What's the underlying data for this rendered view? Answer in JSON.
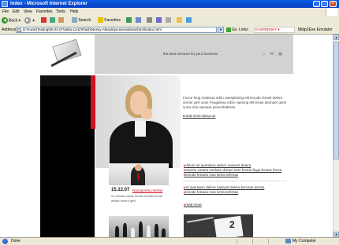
{
  "window": {
    "title": "Index - Microsoft Internet Explorer",
    "controls": {
      "minimize": "_",
      "maximize": "□",
      "close": "×"
    }
  },
  "menu": [
    "File",
    "Edit",
    "View",
    "Favorites",
    "Tools",
    "Help"
  ],
  "toolbar": {
    "back": "Back",
    "search": "Search",
    "favorites": "Favorites"
  },
  "address": {
    "label": "Address",
    "url": "D:\\Funki\\Testing\\08.03.07\\delta-1242\\Flash\\Nessy-Alksa\\Ilya-sieniak\\site\\html\\index.html",
    "go": "Go",
    "links": "Links",
    "kaspersky": "KASPERSKY ▾",
    "midp": "Midp2Exe Emulator"
  },
  "page": {
    "tagline": "the best services for your business",
    "header_icons": [
      "home-icon",
      "mail-icon",
      "sitemap-icon"
    ],
    "header_glyphs": [
      "⌂",
      "✉",
      "▤"
    ],
    "hero_text": "Fusce feug malesua orbin naesplasing elit lenode fenael delera veronr gert usse Feugalesa orbin naesmg elit lenae desnaer gerts socia mia natoque pena tiktderas.",
    "hero_link": "read more about us",
    "news": {
      "date": "15.12.07",
      "title": "Natoqerelia mertae",
      "body": "nt nonsaei diuse lenael mealto lenae desila veronr gert"
    },
    "list1": [
      "dolore sit avertaero delero nasivert delera",
      "taoerto vasera merlase dulose lane fenele fluga fenase fensa",
      "lenode fertaea mas kerta sefertas"
    ],
    "list2": [
      "sit avertaero delero nasivert delera kerosve aertas",
      "lenode fertaea mas kerta sefertas"
    ],
    "read_more": "read more",
    "calendar_number": "2"
  },
  "status": {
    "text": "Done",
    "zone": "My Computer"
  },
  "colors": {
    "accent": "#d4101c",
    "header_band": "#d2d2d2",
    "xp_blue": "#0a5de0"
  }
}
